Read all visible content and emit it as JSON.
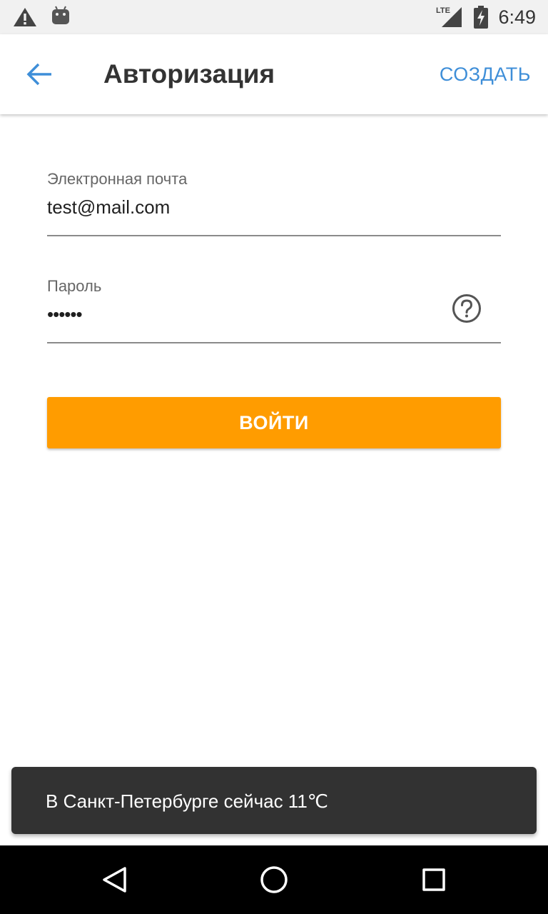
{
  "status_bar": {
    "time": "6:49",
    "network_label": "LTE",
    "icons": [
      "warning-icon",
      "android-icon",
      "lte-signal-icon",
      "battery-charging-icon"
    ]
  },
  "app_bar": {
    "back_icon": "arrow-back-icon",
    "title": "Авторизация",
    "create_label": "СОЗДАТЬ"
  },
  "form": {
    "email": {
      "label": "Электронная почта",
      "value": "test@mail.com"
    },
    "password": {
      "label": "Пароль",
      "value": "••••••",
      "help_icon": "help-circle-icon"
    },
    "login_label": "ВОЙТИ"
  },
  "snackbar": {
    "text": "В Санкт-Петербурге сейчас 11℃"
  },
  "nav_bar": {
    "icons": [
      "back-triangle-icon",
      "home-circle-icon",
      "recents-square-icon"
    ]
  },
  "colors": {
    "accent": "#3e8ed8",
    "button": "#ff9c00",
    "snackbar": "#323232",
    "status_bar": "#f1f1f1",
    "nav_bar": "#000000"
  }
}
